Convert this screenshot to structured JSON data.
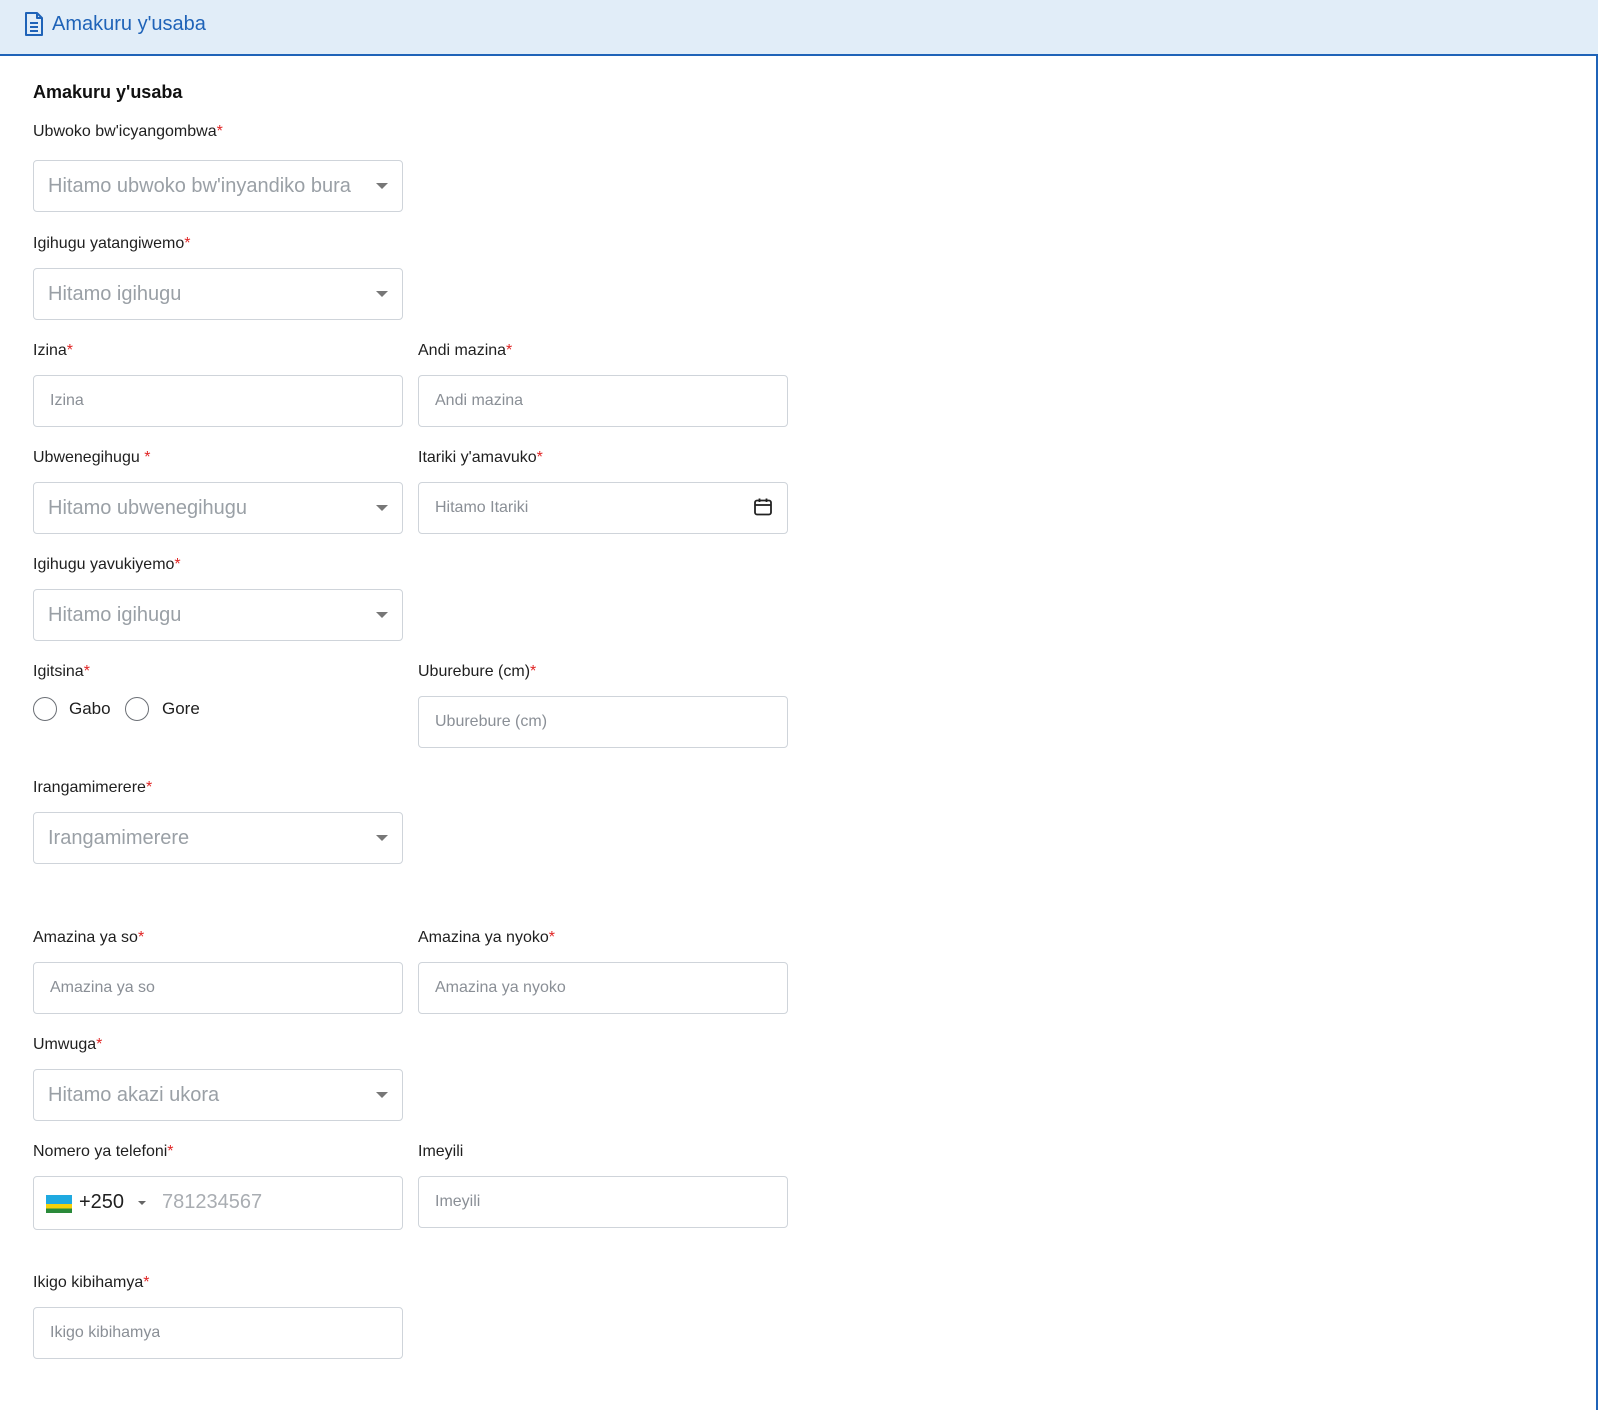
{
  "header": {
    "title": "Amakuru y'usaba",
    "icon": "document-icon"
  },
  "section": {
    "title": "Amakuru y'usaba"
  },
  "required_mark": "*",
  "fields": {
    "document_type": {
      "label": "Ubwoko bw'icyangombwa",
      "placeholder": "Hitamo ubwoko bw'inyandiko bura"
    },
    "origin_country": {
      "label": "Igihugu yatangiwemo",
      "placeholder": "Hitamo igihugu"
    },
    "first_name": {
      "label": "Izina",
      "placeholder": "Izina"
    },
    "other_names": {
      "label": "Andi mazina",
      "placeholder": "Andi mazina"
    },
    "nationality": {
      "label": "Ubwenegihugu ",
      "placeholder": "Hitamo ubwenegihugu"
    },
    "birth_date": {
      "label": "Itariki y'amavuko",
      "placeholder": "Hitamo Itariki"
    },
    "birth_country": {
      "label": "Igihugu yavukiyemo",
      "placeholder": "Hitamo igihugu"
    },
    "gender": {
      "label": "Igitsina",
      "options": [
        "Gabo",
        "Gore"
      ]
    },
    "height": {
      "label": "Uburebure (cm)",
      "placeholder": "Uburebure (cm)"
    },
    "marital_status": {
      "label": "Irangamimerere",
      "placeholder": "Irangamimerere"
    },
    "father_name": {
      "label": "Amazina ya so",
      "placeholder": "Amazina ya so"
    },
    "mother_name": {
      "label": "Amazina ya nyoko",
      "placeholder": "Amazina ya nyoko"
    },
    "occupation": {
      "label": "Umwuga",
      "placeholder": "Hitamo akazi ukora"
    },
    "phone": {
      "label": "Nomero ya telefoni",
      "country_code": "+250",
      "placeholder": "781234567",
      "flag": "rwanda-flag-icon"
    },
    "email": {
      "label": "Imeyili",
      "placeholder": "Imeyili"
    },
    "institution": {
      "label": "Ikigo kibihamya",
      "placeholder": "Ikigo kibihamya"
    }
  },
  "colors": {
    "accent": "#1f63b8",
    "header_bg": "#e1edf8",
    "required": "#e02424"
  }
}
